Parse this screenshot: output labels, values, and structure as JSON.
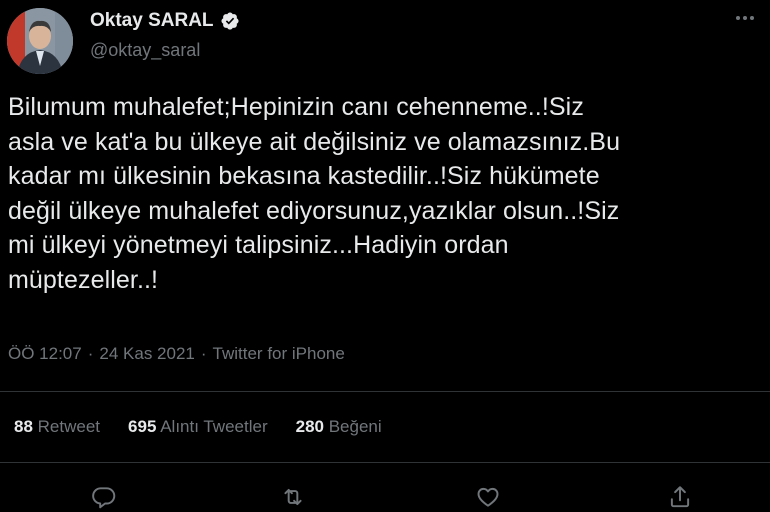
{
  "author": {
    "display_name": "Oktay SARAL",
    "handle": "@oktay_saral",
    "verified": true
  },
  "tweet": {
    "text": "Bilumum muhalefet;Hepinizin canı cehenneme..!Siz\nasla ve kat'a bu ülkeye ait değilsiniz ve olamazsınız.Bu\nkadar mı ülkesinin bekasına kastedilir..!Siz hükümete\ndeğil ülkeye muhalefet ediyorsunuz,yazıklar olsun..!Siz\nmi ülkeyi yönetmeyi talipsiniz...Hadiyin ordan\nmüptezeller..!",
    "time": "ÖÖ 12:07",
    "separator1": "·",
    "date": "24 Kas 2021",
    "separator2": "·",
    "source": "Twitter for iPhone"
  },
  "stats": {
    "retweets": {
      "count": "88",
      "label": "Retweet"
    },
    "quotes": {
      "count": "695",
      "label": "Alıntı Tweetler"
    },
    "likes": {
      "count": "280",
      "label": "Beğeni"
    }
  },
  "icons": {
    "more": "more-icon",
    "reply": "reply-icon",
    "retweet": "retweet-icon",
    "like": "like-icon",
    "share": "share-icon",
    "verified": "verified-badge-icon"
  },
  "colors": {
    "background": "#000000",
    "text": "#e7e9ea",
    "secondary_text": "#71767b",
    "divider": "#2f3336",
    "verified_badge": "#e7e9ea"
  }
}
